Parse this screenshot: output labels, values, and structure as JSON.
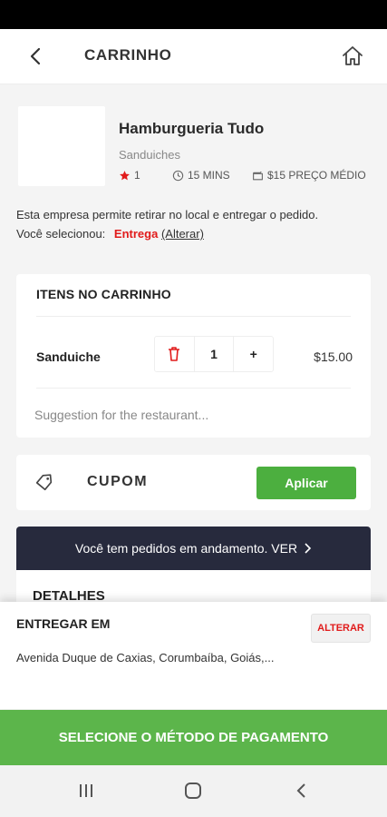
{
  "header": {
    "title": "CARRINHO"
  },
  "restaurant": {
    "name": "Hamburgueria Tudo",
    "category": "Sanduiches",
    "rating": "1",
    "time": "15 MINS",
    "avg_price": "$15 PREÇO MÉDIO",
    "note_line1": "Esta empresa permite retirar no local e entregar o pedido.",
    "selected_prefix": "Você selecionou:",
    "selected_mode": "Entrega",
    "change_link": "(Alterar)"
  },
  "cart": {
    "title": "ITENS NO CARRINHO",
    "items": [
      {
        "name": "Sanduiche",
        "quantity": "1",
        "price": "$15.00"
      }
    ],
    "suggestion_placeholder": "Suggestion for the restaurant..."
  },
  "coupon": {
    "label": "CUPOM",
    "apply_label": "Aplicar"
  },
  "orders_banner": {
    "text": "Você tem pedidos em andamento. VER"
  },
  "details": {
    "title": "DETALHES"
  },
  "delivery": {
    "title": "ENTREGAR EM",
    "change_label": "ALTERAR",
    "address": "Avenida Duque de Caxias, Corumbaíba, Goiás,..."
  },
  "payment": {
    "button_label": "SELECIONE O MÉTODO DE PAGAMENTO"
  },
  "colors": {
    "accent_green": "#5cb54b",
    "accent_red": "#e11b1b",
    "banner_dark": "#272a3d"
  },
  "icons": {
    "back": "arrow-left",
    "home": "home",
    "star": "star",
    "clock": "clock",
    "wallet": "wallet",
    "trash": "trash",
    "tag": "tag",
    "chevron": "chevron-right",
    "nav_recent": "recent-apps",
    "nav_home": "circle",
    "nav_back": "chevron-left"
  }
}
